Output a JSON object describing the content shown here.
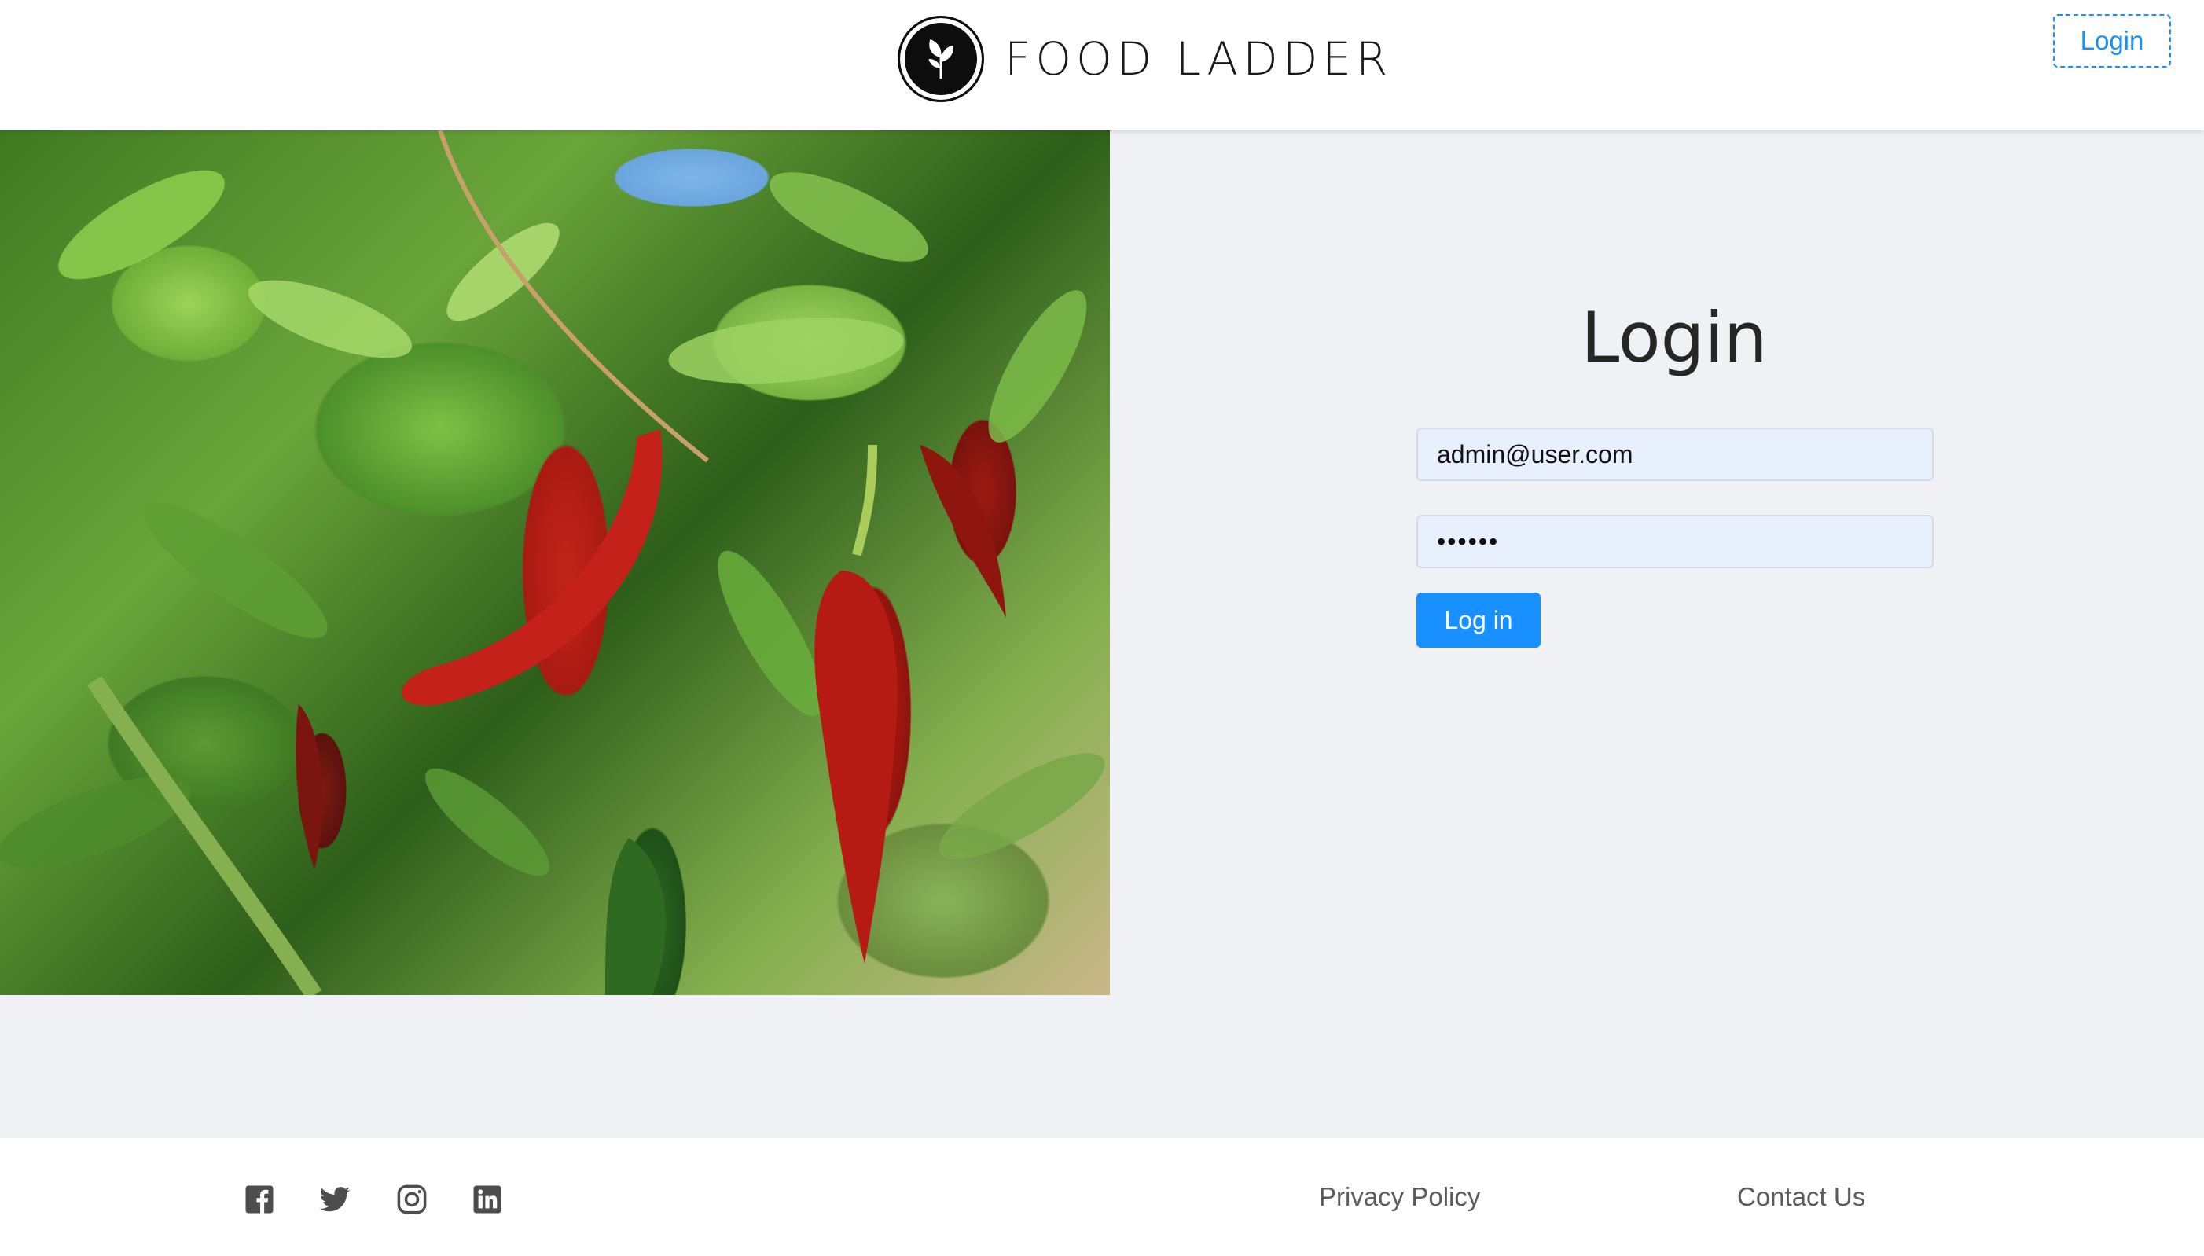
{
  "header": {
    "brand_name": "FOOD LADDER",
    "login_label": "Login"
  },
  "hero": {
    "image_subject": "red chili peppers on plant"
  },
  "login_form": {
    "title": "Login",
    "email_value": "admin@user.com",
    "password_value": "••••••",
    "submit_label": "Log in"
  },
  "footer": {
    "social_icons": [
      "facebook-icon",
      "twitter-icon",
      "instagram-icon",
      "linkedin-icon"
    ],
    "privacy_label": "Privacy Policy",
    "contact_label": "Contact Us"
  },
  "colors": {
    "accent": "#1890ff",
    "page_background": "#f0f1f5",
    "input_background": "#e8f0fe"
  }
}
